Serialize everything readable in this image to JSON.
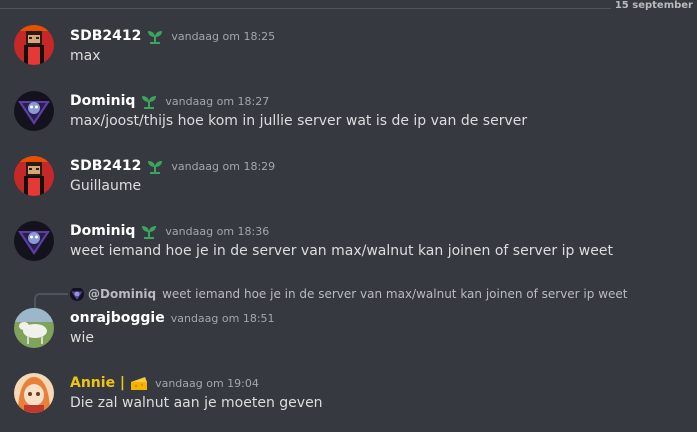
{
  "divider": {
    "date": "15 september"
  },
  "messages": [
    {
      "author": "SDB2412",
      "time": "vandaag om 18:25",
      "text": "max"
    },
    {
      "author": "Dominiq",
      "time": "vandaag om 18:27",
      "text": "max/joost/thijs hoe kom in jullie server wat is de ip van de server"
    },
    {
      "author": "SDB2412",
      "time": "vandaag om 18:29",
      "text": "Guillaume"
    },
    {
      "author": "Dominiq",
      "time": "vandaag om 18:36",
      "text": "weet iemand hoe je in de server van max/walnut kan joinen of server ip weet"
    },
    {
      "author": "onrajboggie",
      "time": "vandaag om 18:51",
      "text": "wie",
      "reply": {
        "author": "@Dominiq",
        "text": "weet iemand hoe je in de server van max/walnut kan joinen of server ip weet"
      }
    },
    {
      "author": "Annie |",
      "time": "vandaag om 19:04",
      "text": "Die zal walnut aan je moeten geven"
    }
  ],
  "colors": {
    "background": "#36393f",
    "author_gold": "#f1c40f",
    "text": "#dcddde"
  },
  "icons": {
    "plant_badge": "sprout-icon",
    "cheese_badge": "cheese-icon"
  }
}
